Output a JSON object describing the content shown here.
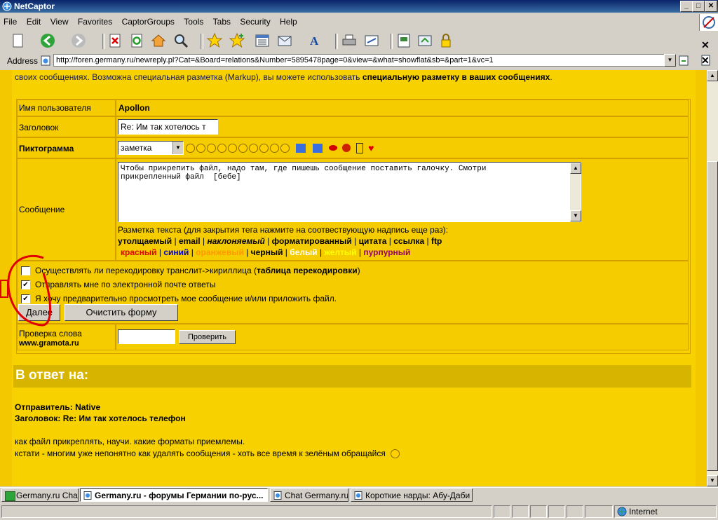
{
  "window": {
    "title": "NetCaptor",
    "minimize": "_",
    "maximize": "□",
    "close": "✕"
  },
  "menu": [
    "File",
    "Edit",
    "View",
    "Favorites",
    "CaptorGroups",
    "Tools",
    "Tabs",
    "Security",
    "Help"
  ],
  "toolbar_icons": [
    "new-page-icon",
    "back-icon",
    "forward-icon",
    "stop-icon",
    "refresh-icon",
    "home-icon",
    "search-icon",
    "favorites-icon",
    "add-favorite-icon",
    "history-icon",
    "mail-icon",
    "font-icon",
    "print-icon",
    "edit-icon",
    "page-icon",
    "popup-icon",
    "lock-icon"
  ],
  "address": {
    "label": "Address",
    "url": "http://foren.germany.ru/newreply.pl?Cat=&Board=relations&Number=5895478page=0&view=&what=showflat&sb=&part=1&vc=1"
  },
  "intro": {
    "text": "своих сообщениях. Возможна специальная разметка (Markup), вы можете использовать ",
    "link": "специальную разметку в ваших сообщениях",
    "end": "."
  },
  "form": {
    "username_label": "Имя пользователя",
    "username_value": "Apollon",
    "subject_label": "Заголовок",
    "subject_value": "Re: Им так хотелось т",
    "icon_label": "Пиктограмма",
    "icon_select": "заметка",
    "message_label": "Сообщение",
    "message_value": "Чтобы прикрепить файл, надо там, где пишешь сообщение поставить галочку. Смотри\nприкрепленный файл  [бебе]",
    "markup_hint": "Разметка текста (для закрытия тега нажмите на соотвествующую надпись еще раз):",
    "markup_tags": [
      "утолщаемый",
      "email",
      "наклоняемый",
      "форматированный",
      "цитата",
      "ссылка",
      "ftp"
    ],
    "color_tags": [
      {
        "label": "красный",
        "color": "#e00000"
      },
      {
        "label": "синий",
        "color": "#0000cc"
      },
      {
        "label": "оранжевый",
        "color": "#ff9900"
      },
      {
        "label": "черный",
        "color": "#000000"
      },
      {
        "label": "белый",
        "color": "#ffffff"
      },
      {
        "label": "желтый",
        "color": "#ffff00"
      },
      {
        "label": "пурпурный",
        "color": "#990066"
      }
    ],
    "translit_label": "Осуществлять ли перекодировку транслит->кириллица (",
    "translit_link": "таблица перекодировки",
    "translit_end": ")",
    "email_notify_label": "Отправлять мне по электронной почте ответы",
    "preview_label": "Я хочу предварительно просмотреть мое сообщение и/или приложить файл.",
    "next_button": "Далее",
    "clear_button": "Очистить форму",
    "spell_label": "Проверка слова",
    "spell_site": "www.gramota.ru",
    "spell_button": "Проверить"
  },
  "reply": {
    "heading": "В ответ на:",
    "sender": "Отправитель: Native",
    "subject": "Заголовок: Re: Им так хотелось телефон",
    "body1": "как файл прикреплять, научи. какие форматы приемлемы.",
    "body2": "кстати - многим уже непонятно как удалять сообщения - хоть все время к зелёным обращайся"
  },
  "tabs": [
    {
      "label": "Germany.ru Chat",
      "active": false
    },
    {
      "label": "Germany.ru - форумы Германии по-рус...",
      "active": true
    },
    {
      "label": "Chat Germany.ru",
      "active": false
    },
    {
      "label": "Короткие нарды: Абу-Даби",
      "active": false
    }
  ],
  "status": {
    "zone": "Internet"
  },
  "colors": {
    "page_bg": "#f7d200",
    "annotation": "#e00000"
  }
}
